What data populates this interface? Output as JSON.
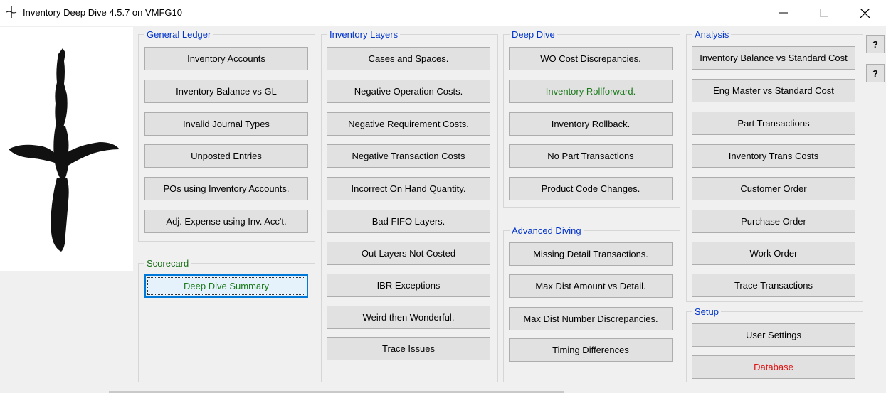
{
  "window": {
    "title": "Inventory Deep Dive 4.5.7 on VMFG10",
    "icon": "diver-app-icon",
    "controls": [
      "minimize",
      "maximize",
      "close"
    ]
  },
  "groups": {
    "general_ledger": {
      "label": "General Ledger",
      "buttons": [
        "Inventory Accounts",
        "Inventory Balance vs GL",
        "Invalid Journal Types",
        "Unposted Entries",
        "POs using Inventory Accounts.",
        "Adj. Expense using Inv. Acc't."
      ]
    },
    "scorecard": {
      "label": "Scorecard",
      "buttons": [
        "Deep Dive Summary"
      ]
    },
    "inventory_layers": {
      "label": "Inventory Layers",
      "buttons": [
        "Cases and Spaces.",
        "Negative Operation Costs.",
        "Negative Requirement Costs.",
        "Negative Transaction Costs",
        "Incorrect On Hand Quantity.",
        "Bad FIFO Layers.",
        "Out Layers Not Costed",
        "IBR Exceptions",
        "Weird then Wonderful.",
        "Trace Issues"
      ]
    },
    "deep_dive": {
      "label": "Deep Dive",
      "buttons": [
        "WO Cost Discrepancies.",
        "Inventory Rollforward.",
        "Inventory Rollback.",
        "No Part Transactions",
        "Product Code Changes."
      ]
    },
    "advanced_diving": {
      "label": "Advanced Diving",
      "buttons": [
        "Missing Detail Transactions.",
        "Max Dist Amount vs Detail.",
        "Max Dist Number Discrepancies.",
        "Timing Differences"
      ]
    },
    "analysis": {
      "label": "Analysis",
      "buttons": [
        "Inventory Balance vs Standard Cost",
        "Eng Master vs Standard Cost",
        "Part Transactions",
        "Inventory Trans Costs",
        "Customer Order",
        "Purchase Order",
        "Work Order",
        "Trace Transactions"
      ]
    },
    "setup": {
      "label": "Setup",
      "buttons": [
        "User Settings",
        "Database"
      ]
    }
  },
  "help_buttons": [
    "?",
    "?"
  ],
  "colors": {
    "group_label": "#0033cc",
    "scorecard_label": "#1a6e1a",
    "green_text": "#1a7a1a",
    "database_text": "#e01010",
    "focus": "#0078d7"
  }
}
